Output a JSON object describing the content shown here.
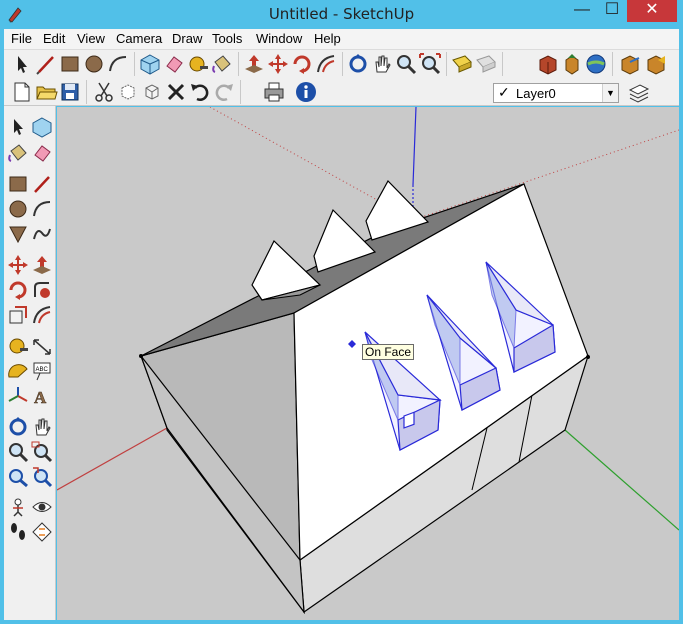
{
  "window": {
    "title": "Untitled - SketchUp",
    "minimize_glyph": "—",
    "maximize_glyph": "☐",
    "close_glyph": "✕"
  },
  "menu": [
    "File",
    "Edit",
    "View",
    "Camera",
    "Draw",
    "Tools",
    "Window",
    "Help"
  ],
  "toolbar_top": [
    "select",
    "line",
    "rectangle",
    "circle",
    "arc",
    "make-component",
    "eraser",
    "tape-measure",
    "paint-bucket",
    "push-pull",
    "move",
    "rotate",
    "offset",
    "orbit",
    "pan",
    "zoom",
    "zoom-extents",
    "previous-view",
    "next-view",
    "get-models",
    "share-model",
    "add-location",
    "toggle-terrain",
    "photo-textures",
    "get-photo-texture"
  ],
  "toolbar_bottom": [
    "new",
    "open",
    "save",
    "cut",
    "copy",
    "paste",
    "erase",
    "undo",
    "redo",
    "print",
    "model-info"
  ],
  "layers": {
    "current": "Layer0",
    "checked": true,
    "manager_icon": "layer-manager-icon"
  },
  "tool_palette": [
    "select",
    "make-component",
    "paint-bucket",
    "eraser",
    "rectangle",
    "line",
    "circle",
    "arc",
    "polygon",
    "freehand",
    "move",
    "push-pull",
    "rotate",
    "follow-me",
    "scale",
    "offset",
    "tape-measure",
    "dimension",
    "protractor",
    "text",
    "axes",
    "3d-text",
    "orbit",
    "pan",
    "zoom",
    "zoom-window",
    "zoom-extents",
    "previous",
    "position-camera",
    "look-around",
    "walk",
    "section-plane"
  ],
  "viewport": {
    "tooltip": "On Face",
    "background_color": "#c9c9c9",
    "selection_color": "#2a2ad8"
  }
}
